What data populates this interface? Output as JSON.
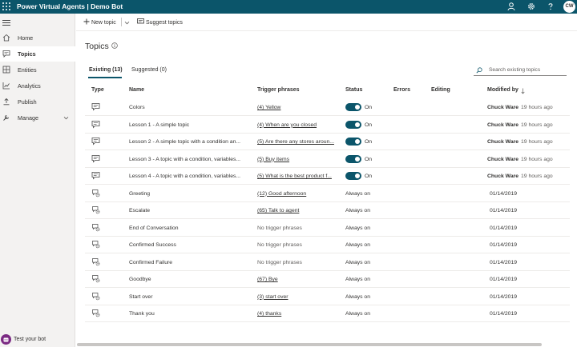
{
  "header": {
    "title": "Power Virtual Agents | Demo Bot",
    "avatar_initials": "CW",
    "color": "#0b556a",
    "icons": [
      "waffle-icon",
      "person-icon",
      "gear-icon",
      "help-icon"
    ]
  },
  "sidebar": {
    "items": [
      {
        "label": "Home",
        "icon": "home-icon"
      },
      {
        "label": "Topics",
        "icon": "chat-icon",
        "active": true
      },
      {
        "label": "Entities",
        "icon": "grid-icon"
      },
      {
        "label": "Analytics",
        "icon": "chart-icon"
      },
      {
        "label": "Publish",
        "icon": "upload-icon"
      },
      {
        "label": "Manage",
        "icon": "wrench-icon"
      }
    ],
    "test_bot": "Test your bot"
  },
  "toolbar": {
    "new_topic": "New topic",
    "suggest_topics": "Suggest topics"
  },
  "main": {
    "title": "Topics",
    "tabs": [
      {
        "label": "Existing (13)",
        "active": true
      },
      {
        "label": "Suggested (0)"
      }
    ],
    "search_placeholder": "Search existing topics",
    "columns": {
      "type": "Type",
      "name": "Name",
      "trigger": "Trigger phrases",
      "status": "Status",
      "errors": "Errors",
      "editing": "Editing",
      "modified": "Modified by"
    },
    "rows": [
      {
        "type": "user",
        "name": "Colors",
        "trigger": "(4) Yellow",
        "status_on": true,
        "status": "On",
        "modified_by": "Chuck Ware",
        "modified_time": "19 hours ago"
      },
      {
        "type": "user",
        "name": "Lesson 1 - A simple topic",
        "trigger": "(4) When are you closed",
        "status_on": true,
        "status": "On",
        "modified_by": "Chuck Ware",
        "modified_time": "19 hours ago"
      },
      {
        "type": "user",
        "name": "Lesson 2 - A simple topic with a condition an...",
        "trigger": "(5) Are there any stores aroun...",
        "status_on": true,
        "status": "On",
        "modified_by": "Chuck Ware",
        "modified_time": "19 hours ago"
      },
      {
        "type": "user",
        "name": "Lesson 3 - A topic with a condition, variables...",
        "trigger": "(5) Buy items",
        "status_on": true,
        "status": "On",
        "modified_by": "Chuck Ware",
        "modified_time": "19 hours ago"
      },
      {
        "type": "user",
        "name": "Lesson 4 - A topic with a condition, variables...",
        "trigger": "(5) What is the best product f...",
        "status_on": true,
        "status": "On",
        "modified_by": "Chuck Ware",
        "modified_time": "19 hours ago"
      },
      {
        "type": "system",
        "name": "Greeting",
        "trigger": "(12) Good afternoon",
        "status": "Always on",
        "modified_time": "01/14/2019"
      },
      {
        "type": "system",
        "name": "Escalate",
        "trigger": "(65) Talk to agent",
        "status": "Always on",
        "modified_time": "01/14/2019"
      },
      {
        "type": "system",
        "name": "End of Conversation",
        "trigger": "No trigger phrases",
        "trigger_muted": true,
        "status": "Always on",
        "modified_time": "01/14/2019"
      },
      {
        "type": "system",
        "name": "Confirmed Success",
        "trigger": "No trigger phrases",
        "trigger_muted": true,
        "status": "Always on",
        "modified_time": "01/14/2019"
      },
      {
        "type": "system",
        "name": "Confirmed Failure",
        "trigger": "No trigger phrases",
        "trigger_muted": true,
        "status": "Always on",
        "modified_time": "01/14/2019"
      },
      {
        "type": "system",
        "name": "Goodbye",
        "trigger": "(67) Bye",
        "status": "Always on",
        "modified_time": "01/14/2019"
      },
      {
        "type": "system",
        "name": "Start over",
        "trigger": "(3) start over",
        "status": "Always on",
        "modified_time": "01/14/2019"
      },
      {
        "type": "system",
        "name": "Thank you",
        "trigger": "(4) thanks",
        "status": "Always on",
        "modified_time": "01/14/2019"
      }
    ]
  }
}
